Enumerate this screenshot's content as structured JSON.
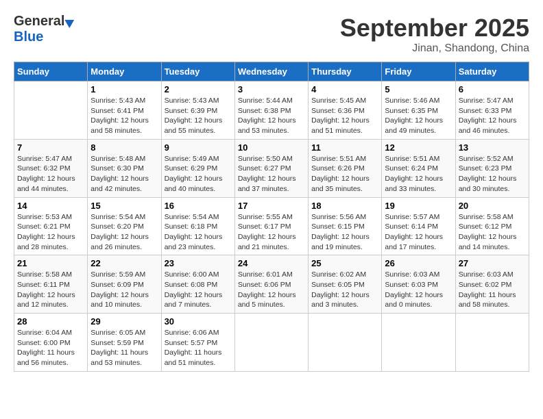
{
  "header": {
    "logo_general": "General",
    "logo_blue": "Blue",
    "month": "September 2025",
    "location": "Jinan, Shandong, China"
  },
  "days_of_week": [
    "Sunday",
    "Monday",
    "Tuesday",
    "Wednesday",
    "Thursday",
    "Friday",
    "Saturday"
  ],
  "weeks": [
    [
      {
        "day": "",
        "info": ""
      },
      {
        "day": "1",
        "info": "Sunrise: 5:43 AM\nSunset: 6:41 PM\nDaylight: 12 hours\nand 58 minutes."
      },
      {
        "day": "2",
        "info": "Sunrise: 5:43 AM\nSunset: 6:39 PM\nDaylight: 12 hours\nand 55 minutes."
      },
      {
        "day": "3",
        "info": "Sunrise: 5:44 AM\nSunset: 6:38 PM\nDaylight: 12 hours\nand 53 minutes."
      },
      {
        "day": "4",
        "info": "Sunrise: 5:45 AM\nSunset: 6:36 PM\nDaylight: 12 hours\nand 51 minutes."
      },
      {
        "day": "5",
        "info": "Sunrise: 5:46 AM\nSunset: 6:35 PM\nDaylight: 12 hours\nand 49 minutes."
      },
      {
        "day": "6",
        "info": "Sunrise: 5:47 AM\nSunset: 6:33 PM\nDaylight: 12 hours\nand 46 minutes."
      }
    ],
    [
      {
        "day": "7",
        "info": "Sunrise: 5:47 AM\nSunset: 6:32 PM\nDaylight: 12 hours\nand 44 minutes."
      },
      {
        "day": "8",
        "info": "Sunrise: 5:48 AM\nSunset: 6:30 PM\nDaylight: 12 hours\nand 42 minutes."
      },
      {
        "day": "9",
        "info": "Sunrise: 5:49 AM\nSunset: 6:29 PM\nDaylight: 12 hours\nand 40 minutes."
      },
      {
        "day": "10",
        "info": "Sunrise: 5:50 AM\nSunset: 6:27 PM\nDaylight: 12 hours\nand 37 minutes."
      },
      {
        "day": "11",
        "info": "Sunrise: 5:51 AM\nSunset: 6:26 PM\nDaylight: 12 hours\nand 35 minutes."
      },
      {
        "day": "12",
        "info": "Sunrise: 5:51 AM\nSunset: 6:24 PM\nDaylight: 12 hours\nand 33 minutes."
      },
      {
        "day": "13",
        "info": "Sunrise: 5:52 AM\nSunset: 6:23 PM\nDaylight: 12 hours\nand 30 minutes."
      }
    ],
    [
      {
        "day": "14",
        "info": "Sunrise: 5:53 AM\nSunset: 6:21 PM\nDaylight: 12 hours\nand 28 minutes."
      },
      {
        "day": "15",
        "info": "Sunrise: 5:54 AM\nSunset: 6:20 PM\nDaylight: 12 hours\nand 26 minutes."
      },
      {
        "day": "16",
        "info": "Sunrise: 5:54 AM\nSunset: 6:18 PM\nDaylight: 12 hours\nand 23 minutes."
      },
      {
        "day": "17",
        "info": "Sunrise: 5:55 AM\nSunset: 6:17 PM\nDaylight: 12 hours\nand 21 minutes."
      },
      {
        "day": "18",
        "info": "Sunrise: 5:56 AM\nSunset: 6:15 PM\nDaylight: 12 hours\nand 19 minutes."
      },
      {
        "day": "19",
        "info": "Sunrise: 5:57 AM\nSunset: 6:14 PM\nDaylight: 12 hours\nand 17 minutes."
      },
      {
        "day": "20",
        "info": "Sunrise: 5:58 AM\nSunset: 6:12 PM\nDaylight: 12 hours\nand 14 minutes."
      }
    ],
    [
      {
        "day": "21",
        "info": "Sunrise: 5:58 AM\nSunset: 6:11 PM\nDaylight: 12 hours\nand 12 minutes."
      },
      {
        "day": "22",
        "info": "Sunrise: 5:59 AM\nSunset: 6:09 PM\nDaylight: 12 hours\nand 10 minutes."
      },
      {
        "day": "23",
        "info": "Sunrise: 6:00 AM\nSunset: 6:08 PM\nDaylight: 12 hours\nand 7 minutes."
      },
      {
        "day": "24",
        "info": "Sunrise: 6:01 AM\nSunset: 6:06 PM\nDaylight: 12 hours\nand 5 minutes."
      },
      {
        "day": "25",
        "info": "Sunrise: 6:02 AM\nSunset: 6:05 PM\nDaylight: 12 hours\nand 3 minutes."
      },
      {
        "day": "26",
        "info": "Sunrise: 6:03 AM\nSunset: 6:03 PM\nDaylight: 12 hours\nand 0 minutes."
      },
      {
        "day": "27",
        "info": "Sunrise: 6:03 AM\nSunset: 6:02 PM\nDaylight: 11 hours\nand 58 minutes."
      }
    ],
    [
      {
        "day": "28",
        "info": "Sunrise: 6:04 AM\nSunset: 6:00 PM\nDaylight: 11 hours\nand 56 minutes."
      },
      {
        "day": "29",
        "info": "Sunrise: 6:05 AM\nSunset: 5:59 PM\nDaylight: 11 hours\nand 53 minutes."
      },
      {
        "day": "30",
        "info": "Sunrise: 6:06 AM\nSunset: 5:57 PM\nDaylight: 11 hours\nand 51 minutes."
      },
      {
        "day": "",
        "info": ""
      },
      {
        "day": "",
        "info": ""
      },
      {
        "day": "",
        "info": ""
      },
      {
        "day": "",
        "info": ""
      }
    ]
  ]
}
